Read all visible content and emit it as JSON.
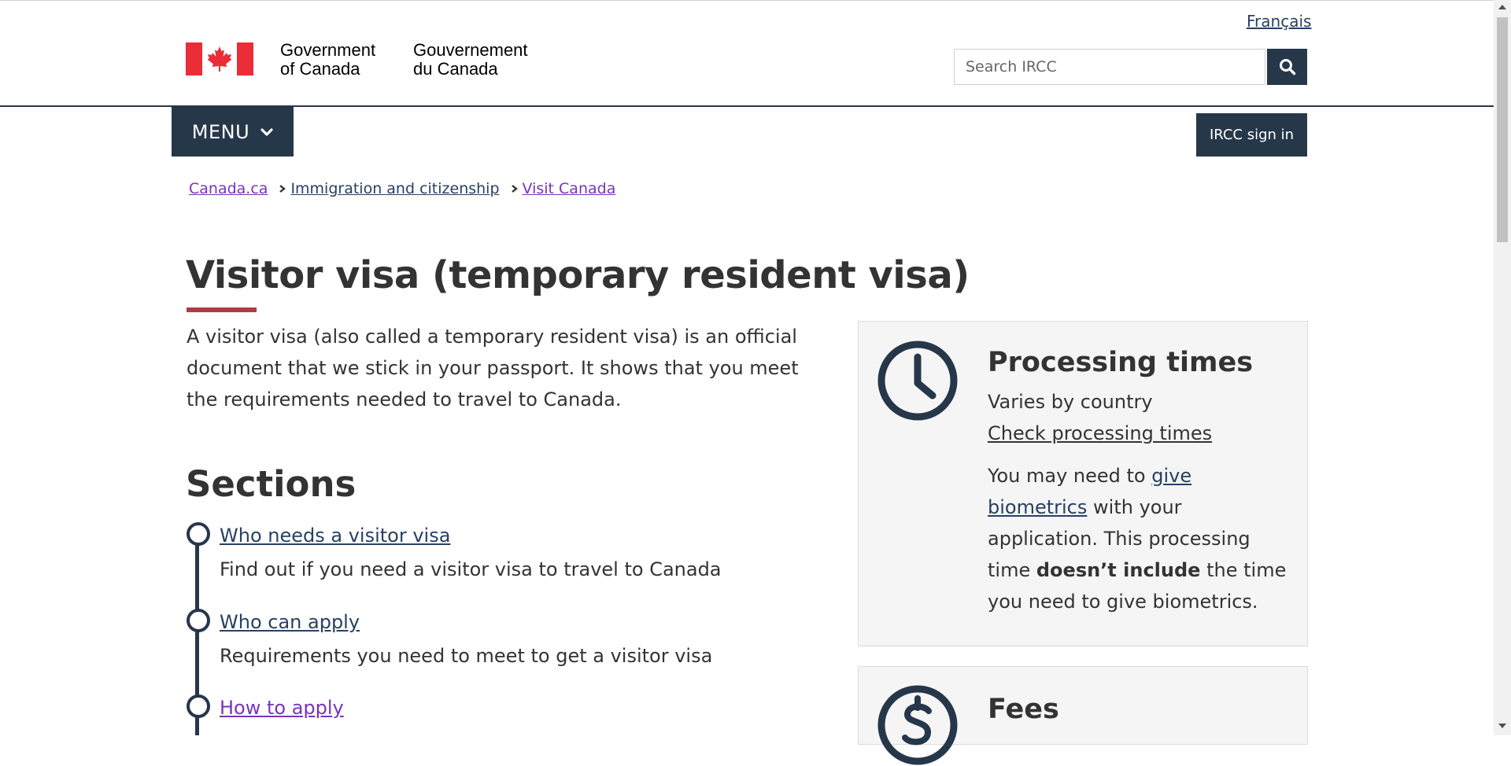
{
  "header": {
    "language_link": "Français",
    "signature_en_line1": "Government",
    "signature_en_line2": "of Canada",
    "signature_fr_line1": "Gouvernement",
    "signature_fr_line2": "du Canada",
    "search_placeholder": "Search IRCC",
    "search_icon": "search-icon"
  },
  "nav": {
    "menu_label": "MENU",
    "menu_icon": "chevron-down-icon",
    "signin_label": "IRCC sign in"
  },
  "breadcrumb": [
    "Canada.ca",
    "Immigration and citizenship",
    "Visit Canada"
  ],
  "main": {
    "title": "Visitor visa (temporary resident visa)",
    "intro": "A visitor visa (also called a temporary resident visa) is an official document that we stick in your passport. It shows that you meet the requirements needed to travel to Canada.",
    "sections_heading": "Sections",
    "sections": [
      {
        "link": "Who needs a visitor visa",
        "desc": "Find out if you need a visitor visa to travel to Canada"
      },
      {
        "link": "Who can apply",
        "desc": "Requirements you need to meet to get a visitor visa"
      },
      {
        "link": "How to apply",
        "desc": ""
      }
    ]
  },
  "processing_panel": {
    "icon": "clock-icon",
    "title": "Processing times",
    "varies": "Varies by country",
    "check_link": "Check processing times",
    "note_prefix": "You may need to",
    "note_link": "give biometrics",
    "note_mid": "with your application. This processing time",
    "note_bold": "doesn’t include",
    "note_suffix": "the time you need to give biometrics."
  },
  "fees_panel": {
    "icon": "dollar-icon",
    "title": "Fees"
  },
  "colors": {
    "primary": "#26374a",
    "link": "#284162",
    "visited_link": "#7834bc",
    "accent_red": "#af3c43",
    "flag_red": "#eb2d37",
    "panel_bg": "#f5f5f5"
  }
}
